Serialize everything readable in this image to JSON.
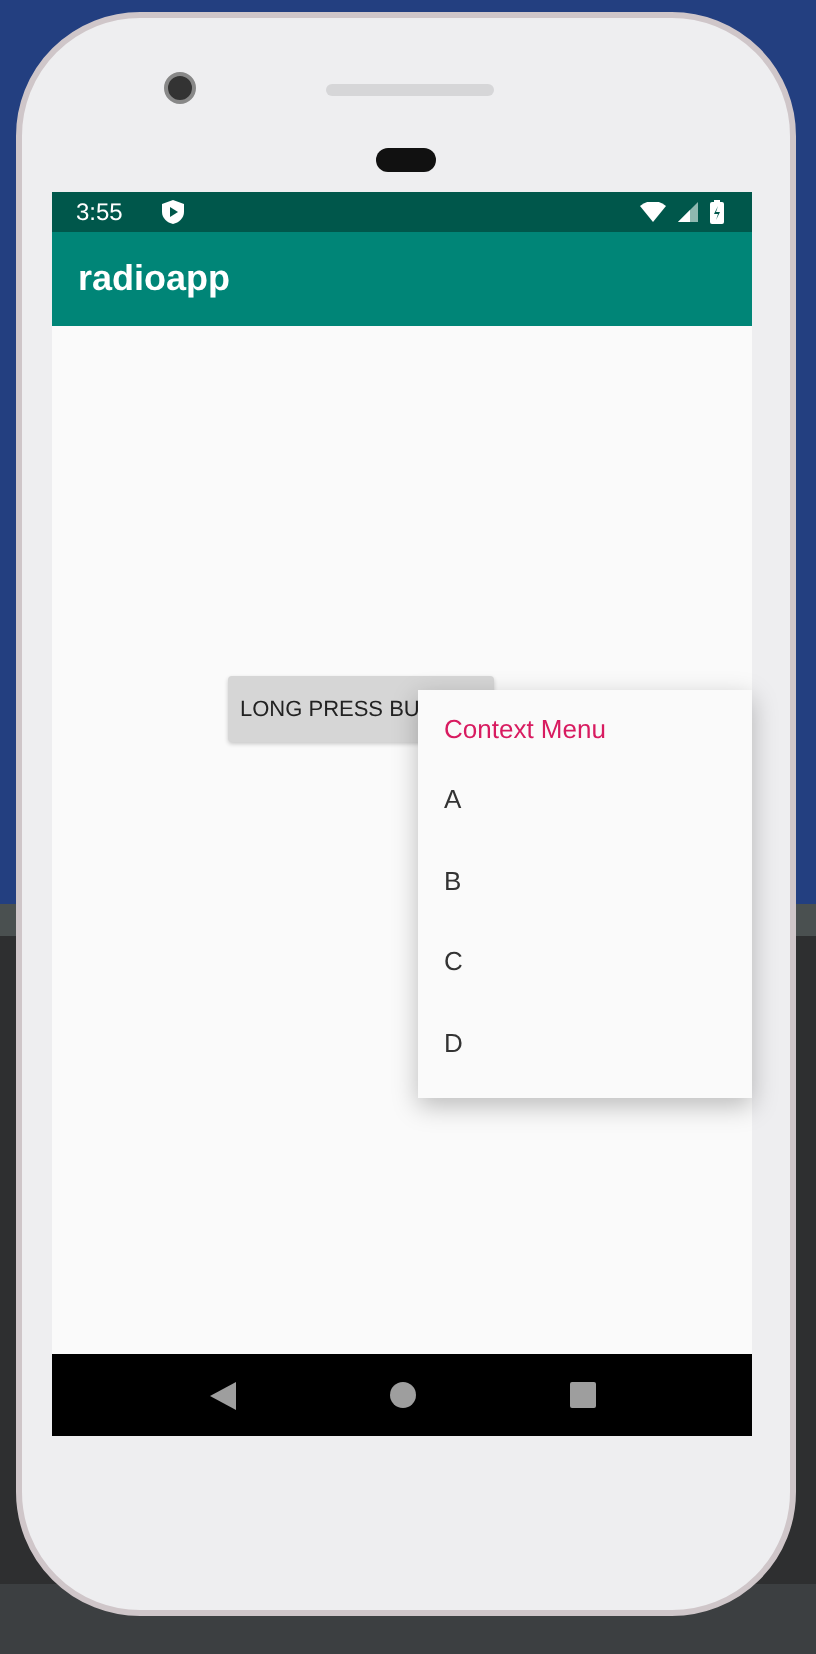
{
  "status_bar": {
    "time": "3:55"
  },
  "app_bar": {
    "title": "radioapp"
  },
  "button": {
    "label": "LONG PRESS BU"
  },
  "context_menu": {
    "title": "Context Menu",
    "items": [
      {
        "label": "A"
      },
      {
        "label": "B"
      },
      {
        "label": "C"
      },
      {
        "label": "D"
      }
    ]
  }
}
